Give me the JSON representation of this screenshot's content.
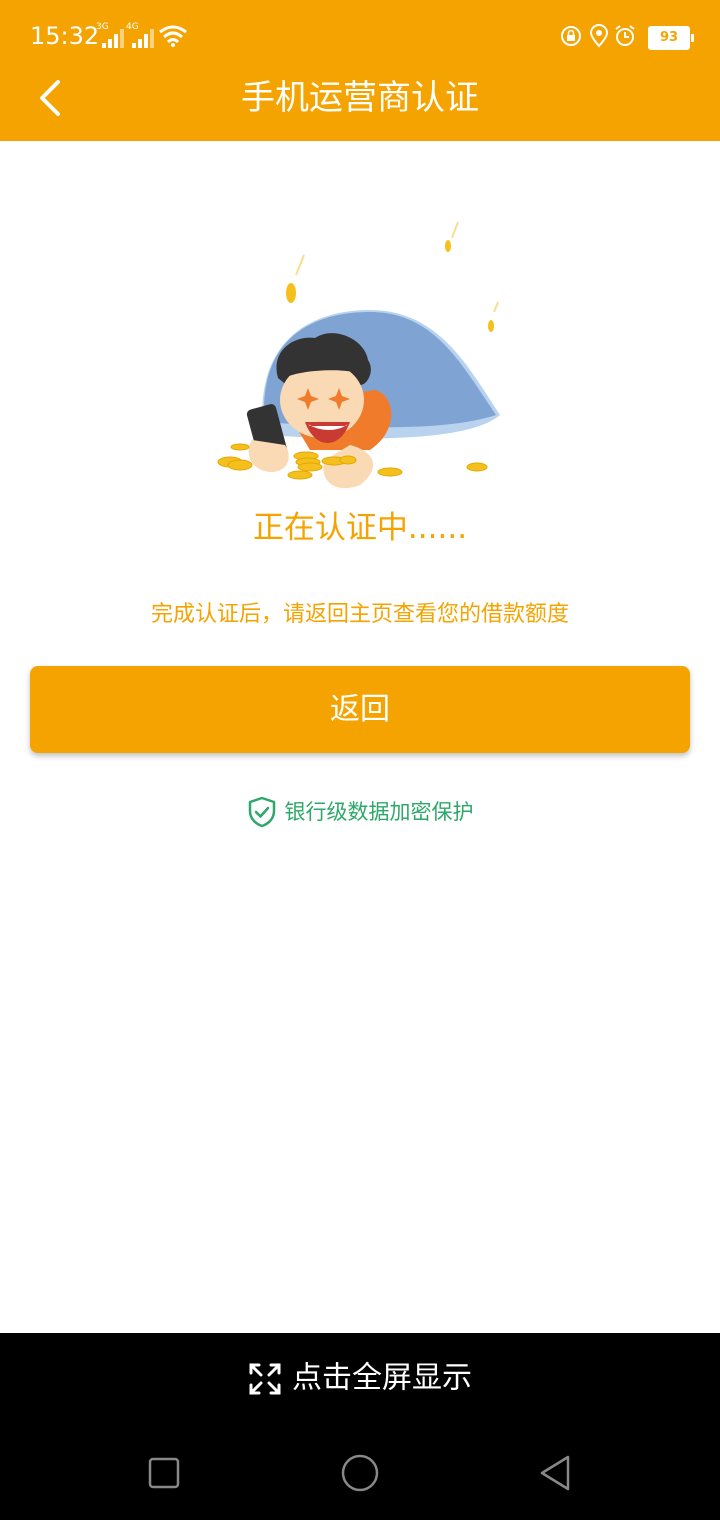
{
  "status_bar": {
    "time": "15:32",
    "network_1": "3G",
    "network_2": "4G",
    "battery": "93"
  },
  "header": {
    "title": "手机运营商认证",
    "back_icon": "chevron-left-icon"
  },
  "main": {
    "status_text": "正在认证中......",
    "hint_text": "完成认证后，请返回主页查看您的借款额度",
    "return_button_label": "返回",
    "security_text": "银行级数据加密保护",
    "security_icon": "shield-check-icon"
  },
  "bottom": {
    "fullscreen_label": "点击全屏显示",
    "fullscreen_icon": "expand-icon"
  },
  "colors": {
    "accent": "#F5A300",
    "security_green": "#2EA86A",
    "nav_bar": "#000000"
  }
}
